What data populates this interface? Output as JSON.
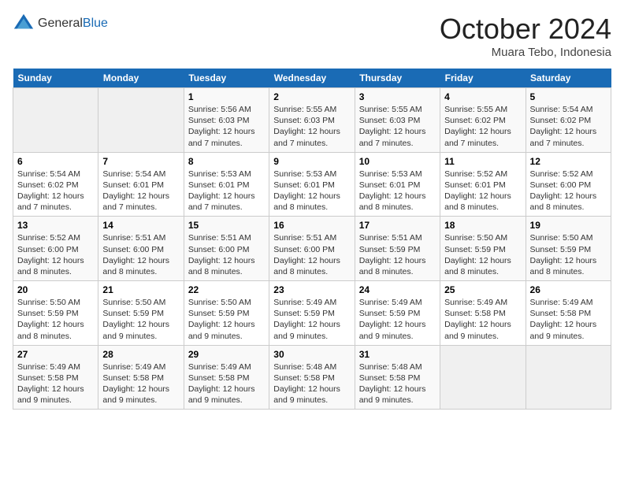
{
  "header": {
    "logo": {
      "general": "General",
      "blue": "Blue"
    },
    "month": "October 2024",
    "location": "Muara Tebo, Indonesia"
  },
  "days_of_week": [
    "Sunday",
    "Monday",
    "Tuesday",
    "Wednesday",
    "Thursday",
    "Friday",
    "Saturday"
  ],
  "weeks": [
    [
      {
        "day": "",
        "sunrise": "",
        "sunset": "",
        "daylight": ""
      },
      {
        "day": "",
        "sunrise": "",
        "sunset": "",
        "daylight": ""
      },
      {
        "day": "1",
        "sunrise": "Sunrise: 5:56 AM",
        "sunset": "Sunset: 6:03 PM",
        "daylight": "Daylight: 12 hours and 7 minutes."
      },
      {
        "day": "2",
        "sunrise": "Sunrise: 5:55 AM",
        "sunset": "Sunset: 6:03 PM",
        "daylight": "Daylight: 12 hours and 7 minutes."
      },
      {
        "day": "3",
        "sunrise": "Sunrise: 5:55 AM",
        "sunset": "Sunset: 6:03 PM",
        "daylight": "Daylight: 12 hours and 7 minutes."
      },
      {
        "day": "4",
        "sunrise": "Sunrise: 5:55 AM",
        "sunset": "Sunset: 6:02 PM",
        "daylight": "Daylight: 12 hours and 7 minutes."
      },
      {
        "day": "5",
        "sunrise": "Sunrise: 5:54 AM",
        "sunset": "Sunset: 6:02 PM",
        "daylight": "Daylight: 12 hours and 7 minutes."
      }
    ],
    [
      {
        "day": "6",
        "sunrise": "Sunrise: 5:54 AM",
        "sunset": "Sunset: 6:02 PM",
        "daylight": "Daylight: 12 hours and 7 minutes."
      },
      {
        "day": "7",
        "sunrise": "Sunrise: 5:54 AM",
        "sunset": "Sunset: 6:01 PM",
        "daylight": "Daylight: 12 hours and 7 minutes."
      },
      {
        "day": "8",
        "sunrise": "Sunrise: 5:53 AM",
        "sunset": "Sunset: 6:01 PM",
        "daylight": "Daylight: 12 hours and 7 minutes."
      },
      {
        "day": "9",
        "sunrise": "Sunrise: 5:53 AM",
        "sunset": "Sunset: 6:01 PM",
        "daylight": "Daylight: 12 hours and 8 minutes."
      },
      {
        "day": "10",
        "sunrise": "Sunrise: 5:53 AM",
        "sunset": "Sunset: 6:01 PM",
        "daylight": "Daylight: 12 hours and 8 minutes."
      },
      {
        "day": "11",
        "sunrise": "Sunrise: 5:52 AM",
        "sunset": "Sunset: 6:01 PM",
        "daylight": "Daylight: 12 hours and 8 minutes."
      },
      {
        "day": "12",
        "sunrise": "Sunrise: 5:52 AM",
        "sunset": "Sunset: 6:00 PM",
        "daylight": "Daylight: 12 hours and 8 minutes."
      }
    ],
    [
      {
        "day": "13",
        "sunrise": "Sunrise: 5:52 AM",
        "sunset": "Sunset: 6:00 PM",
        "daylight": "Daylight: 12 hours and 8 minutes."
      },
      {
        "day": "14",
        "sunrise": "Sunrise: 5:51 AM",
        "sunset": "Sunset: 6:00 PM",
        "daylight": "Daylight: 12 hours and 8 minutes."
      },
      {
        "day": "15",
        "sunrise": "Sunrise: 5:51 AM",
        "sunset": "Sunset: 6:00 PM",
        "daylight": "Daylight: 12 hours and 8 minutes."
      },
      {
        "day": "16",
        "sunrise": "Sunrise: 5:51 AM",
        "sunset": "Sunset: 6:00 PM",
        "daylight": "Daylight: 12 hours and 8 minutes."
      },
      {
        "day": "17",
        "sunrise": "Sunrise: 5:51 AM",
        "sunset": "Sunset: 5:59 PM",
        "daylight": "Daylight: 12 hours and 8 minutes."
      },
      {
        "day": "18",
        "sunrise": "Sunrise: 5:50 AM",
        "sunset": "Sunset: 5:59 PM",
        "daylight": "Daylight: 12 hours and 8 minutes."
      },
      {
        "day": "19",
        "sunrise": "Sunrise: 5:50 AM",
        "sunset": "Sunset: 5:59 PM",
        "daylight": "Daylight: 12 hours and 8 minutes."
      }
    ],
    [
      {
        "day": "20",
        "sunrise": "Sunrise: 5:50 AM",
        "sunset": "Sunset: 5:59 PM",
        "daylight": "Daylight: 12 hours and 8 minutes."
      },
      {
        "day": "21",
        "sunrise": "Sunrise: 5:50 AM",
        "sunset": "Sunset: 5:59 PM",
        "daylight": "Daylight: 12 hours and 9 minutes."
      },
      {
        "day": "22",
        "sunrise": "Sunrise: 5:50 AM",
        "sunset": "Sunset: 5:59 PM",
        "daylight": "Daylight: 12 hours and 9 minutes."
      },
      {
        "day": "23",
        "sunrise": "Sunrise: 5:49 AM",
        "sunset": "Sunset: 5:59 PM",
        "daylight": "Daylight: 12 hours and 9 minutes."
      },
      {
        "day": "24",
        "sunrise": "Sunrise: 5:49 AM",
        "sunset": "Sunset: 5:59 PM",
        "daylight": "Daylight: 12 hours and 9 minutes."
      },
      {
        "day": "25",
        "sunrise": "Sunrise: 5:49 AM",
        "sunset": "Sunset: 5:58 PM",
        "daylight": "Daylight: 12 hours and 9 minutes."
      },
      {
        "day": "26",
        "sunrise": "Sunrise: 5:49 AM",
        "sunset": "Sunset: 5:58 PM",
        "daylight": "Daylight: 12 hours and 9 minutes."
      }
    ],
    [
      {
        "day": "27",
        "sunrise": "Sunrise: 5:49 AM",
        "sunset": "Sunset: 5:58 PM",
        "daylight": "Daylight: 12 hours and 9 minutes."
      },
      {
        "day": "28",
        "sunrise": "Sunrise: 5:49 AM",
        "sunset": "Sunset: 5:58 PM",
        "daylight": "Daylight: 12 hours and 9 minutes."
      },
      {
        "day": "29",
        "sunrise": "Sunrise: 5:49 AM",
        "sunset": "Sunset: 5:58 PM",
        "daylight": "Daylight: 12 hours and 9 minutes."
      },
      {
        "day": "30",
        "sunrise": "Sunrise: 5:48 AM",
        "sunset": "Sunset: 5:58 PM",
        "daylight": "Daylight: 12 hours and 9 minutes."
      },
      {
        "day": "31",
        "sunrise": "Sunrise: 5:48 AM",
        "sunset": "Sunset: 5:58 PM",
        "daylight": "Daylight: 12 hours and 9 minutes."
      },
      {
        "day": "",
        "sunrise": "",
        "sunset": "",
        "daylight": ""
      },
      {
        "day": "",
        "sunrise": "",
        "sunset": "",
        "daylight": ""
      }
    ]
  ]
}
